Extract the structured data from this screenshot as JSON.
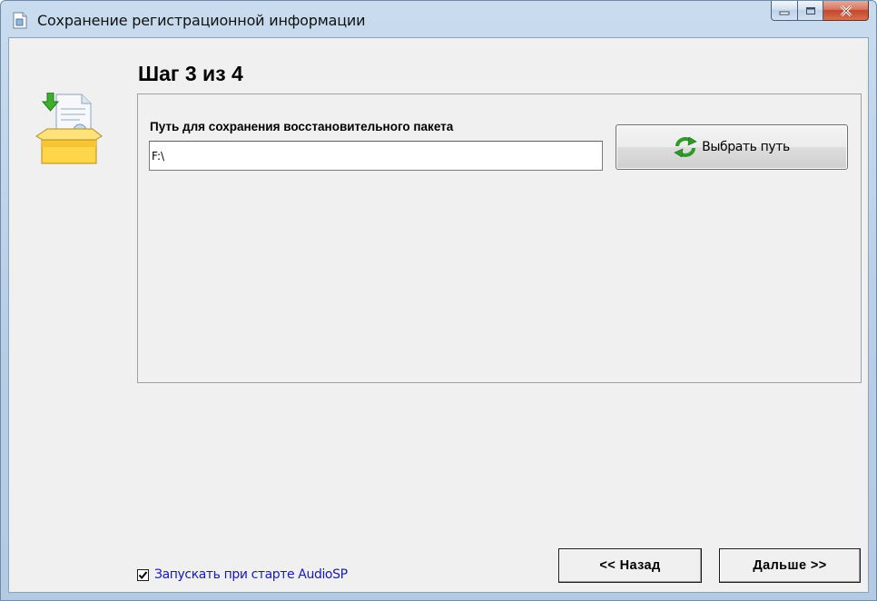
{
  "window": {
    "title": "Сохранение регистрационной информации"
  },
  "wizard": {
    "step_title": "Шаг 3 из 4",
    "path_label": "Путь для сохранения восстановительного пакета",
    "path_value": "F:\\",
    "browse_button": "Выбрать путь",
    "autostart_label": "Запускать при старте AudioSP",
    "autostart_checked": true,
    "back_button": "<< Назад",
    "next_button": "Дальше >>"
  },
  "colors": {
    "titlebar": "#c9dcef",
    "client_bg": "#f0f0f0",
    "link_blue": "#1919b4",
    "close_red": "#c4472b"
  },
  "icons": {
    "app": "document-icon",
    "wizard": "package-box-icon",
    "browse": "refresh-icon"
  }
}
